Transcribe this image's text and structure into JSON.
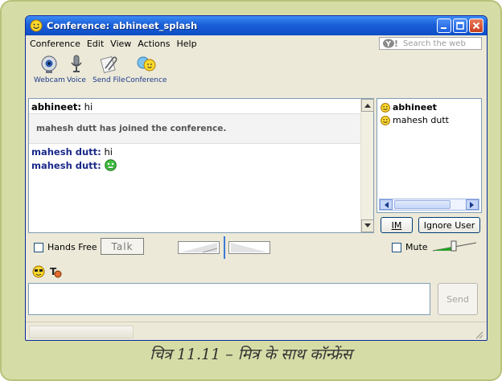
{
  "window": {
    "title": "Conference: abhineet_splash"
  },
  "menu": {
    "items": [
      "Conference",
      "Edit",
      "View",
      "Actions",
      "Help"
    ]
  },
  "search": {
    "placeholder": "Search the web",
    "icon": "yahoo-y-icon"
  },
  "toolbar": {
    "items": [
      {
        "label": "Webcam",
        "icon": "webcam-icon"
      },
      {
        "label": "Voice",
        "icon": "microphone-icon"
      },
      {
        "label": "Send File",
        "icon": "paperclip-icon"
      },
      {
        "label": "Conference",
        "icon": "conference-icon"
      }
    ]
  },
  "chat": {
    "messages": [
      {
        "sender": "abhineet:",
        "text": "hi"
      },
      {
        "system": "mahesh dutt has joined the conference."
      },
      {
        "sender": "mahesh dutt:",
        "text": "hi"
      },
      {
        "sender": "mahesh dutt:",
        "emoticon": "green-smiley-icon"
      }
    ]
  },
  "participants": {
    "users": [
      {
        "name": "abhineet",
        "bold": true
      },
      {
        "name": "mahesh dutt",
        "bold": false
      }
    ],
    "im_label": "IM",
    "ignore_label": "Ignore User"
  },
  "voice": {
    "hands_free_label": "Hands Free",
    "talk_label": "Talk",
    "mute_label": "Mute"
  },
  "compose": {
    "send_label": "Send"
  },
  "caption": "चित्र 11.11 – मित्र के साथ कॉन्फ्रेंस",
  "colors": {
    "titlebar": "#1a5fd8",
    "sender_text": "#1b2a8a",
    "page_background": "#d6dca6"
  }
}
